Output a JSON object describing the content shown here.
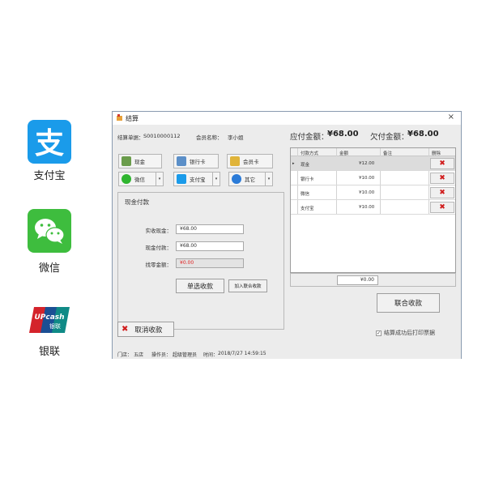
{
  "left_icons": {
    "alipay": {
      "label": "支付宝",
      "icon": "alipay-icon",
      "color": "#1a9bea"
    },
    "wechat": {
      "label": "微信",
      "icon": "wechat-icon",
      "color": "#3ebd3e"
    },
    "unionpay": {
      "label": "银联",
      "icon": "unionpay-icon",
      "logo_text": "UPcash 银联"
    }
  },
  "window": {
    "title": "结算",
    "close": "×"
  },
  "info": {
    "bill_no_label": "结算单据：",
    "bill_no": "S0010000112",
    "member_label": "会员名称：",
    "member": "李小姐",
    "due_label": "应付金额：",
    "due": "¥68.00",
    "owed_label": "欠付金额：",
    "owed": "¥68.00"
  },
  "pay_buttons": {
    "cash": "现金",
    "bank_card": "银行卡",
    "member_card": "会员卡",
    "wechat": "微信",
    "alipay": "支付宝",
    "other": "其它",
    "dropdown_glyph": "▾"
  },
  "cash_panel": {
    "title": "现金付款",
    "received_label": "实收现金：",
    "received": "¥68.00",
    "cash_pay_label": "现金付款：",
    "cash_pay": "¥68.00",
    "change_label": "找零金额：",
    "change": "¥0.00",
    "single_pay_button": "单选收款",
    "add_combined_button": "加入联合收款"
  },
  "grid": {
    "columns": [
      "付款方式",
      "金额",
      "备注",
      "删除"
    ],
    "row_marker": "▸",
    "delete_glyph": "✖",
    "rows": [
      {
        "method": "现金",
        "amount": "¥12.00",
        "note": ""
      },
      {
        "method": "银行卡",
        "amount": "¥10.00",
        "note": ""
      },
      {
        "method": "微信",
        "amount": "¥10.00",
        "note": ""
      },
      {
        "method": "支付宝",
        "amount": "¥10.00",
        "note": ""
      }
    ],
    "total": "¥0.00"
  },
  "combined_pay_button": "联合收款",
  "cancel_button": "取消收款",
  "print_checkbox": "结算成功后打印票据",
  "status": {
    "store_label": "门店：",
    "store": "五店",
    "operator_label": "操作员：",
    "operator": "超级管理员",
    "time_label": "时间：",
    "time": "2018/7/27 14:59:15"
  }
}
